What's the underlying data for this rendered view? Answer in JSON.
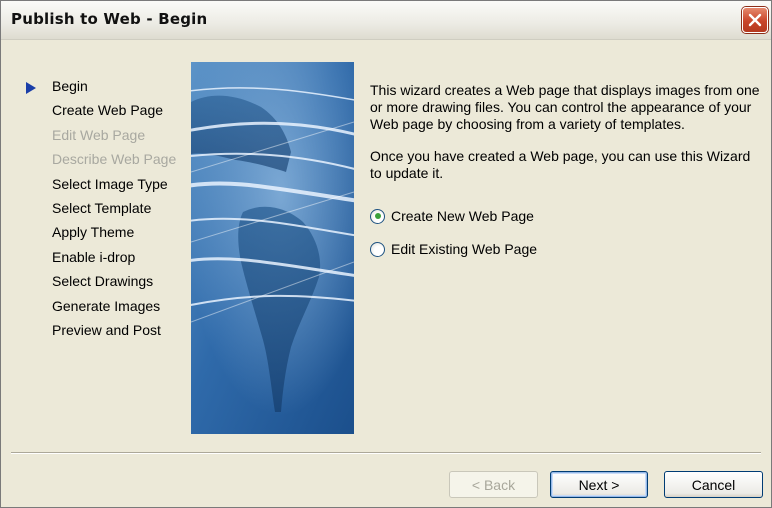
{
  "window": {
    "title": "Publish to Web - Begin"
  },
  "steps": [
    {
      "label": "Begin",
      "state": "current"
    },
    {
      "label": "Create Web Page",
      "state": "enabled"
    },
    {
      "label": "Edit Web Page",
      "state": "disabled"
    },
    {
      "label": "Describe Web Page",
      "state": "disabled"
    },
    {
      "label": "Select Image Type",
      "state": "enabled"
    },
    {
      "label": "Select Template",
      "state": "enabled"
    },
    {
      "label": "Apply Theme",
      "state": "enabled"
    },
    {
      "label": "Enable i-drop",
      "state": "enabled"
    },
    {
      "label": "Select Drawings",
      "state": "enabled"
    },
    {
      "label": "Generate Images",
      "state": "enabled"
    },
    {
      "label": "Preview and Post",
      "state": "enabled"
    }
  ],
  "content": {
    "paragraph1": "This wizard creates a Web page that displays images from one or more drawing files.  You can control the appearance of your Web page by choosing from a variety of templates.",
    "paragraph2": "Once you have created a Web page, you can use this Wizard to update it.",
    "options": [
      {
        "label": "Create New Web Page",
        "selected": true
      },
      {
        "label": "Edit Existing Web Page",
        "selected": false
      }
    ]
  },
  "buttons": {
    "back": "< Back",
    "next": "Next >",
    "cancel": "Cancel"
  },
  "colors": {
    "window_bg": "#ece9d8",
    "close_button": "#c9452a",
    "current_step_arrow": "#1a3ea8",
    "radio_dot": "#3aa03a",
    "disabled_text": "#a8a8a0"
  },
  "icons": {
    "close": "close-x-icon",
    "current_step": "play-arrow-icon"
  }
}
